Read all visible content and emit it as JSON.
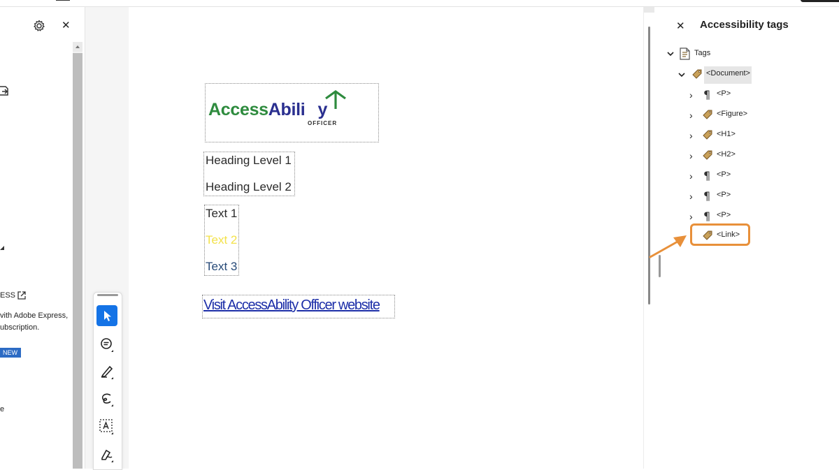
{
  "left_panel": {
    "text_ess": "ESS",
    "text_with_adobe": "vith Adobe Express,",
    "text_subscription": "ubscription.",
    "badge_new": "NEW",
    "text_e": "e"
  },
  "document": {
    "logo": {
      "text_access": "Access",
      "text_abili": "Abili",
      "text_y": "y",
      "subtitle": "OFFICER",
      "color_access": "#2e8b3e",
      "color_ability": "#2a2f8f"
    },
    "heading1": "Heading Level 1",
    "heading2": "Heading Level 2",
    "text1": "Text 1",
    "text2": "Text 2",
    "text3": "Text 3",
    "link": "Visit AccessAbility Officer website",
    "text2_color": "#f3e24a",
    "link_color": "#1c2ea8"
  },
  "right_panel": {
    "title": "Accessibility tags",
    "root": "Tags",
    "document_tag": "<Document>",
    "children": [
      {
        "label": "<P>",
        "icon": "paragraph-icon"
      },
      {
        "label": "<Figure>",
        "icon": "tag-icon"
      },
      {
        "label": "<H1>",
        "icon": "tag-icon"
      },
      {
        "label": "<H2>",
        "icon": "tag-icon"
      },
      {
        "label": "<P>",
        "icon": "paragraph-icon"
      },
      {
        "label": "<P>",
        "icon": "paragraph-icon"
      },
      {
        "label": "<P>",
        "icon": "paragraph-icon"
      }
    ],
    "link_tag": "<Link>",
    "highlight_color": "#e8903a"
  }
}
